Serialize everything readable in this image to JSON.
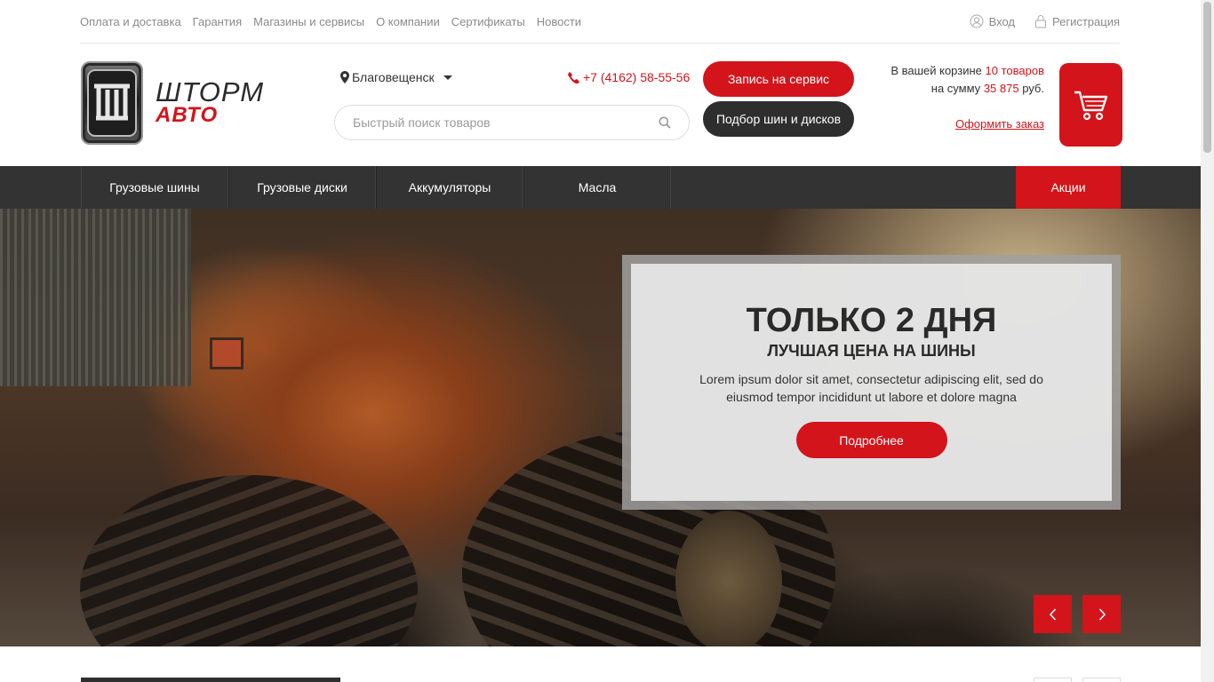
{
  "top_links": [
    "Оплата и доставка",
    "Гарантия",
    "Магазины и сервисы",
    "О компании",
    "Сертификаты",
    "Новости"
  ],
  "account": {
    "login": "Вход",
    "register": "Регистрация"
  },
  "logo": {
    "line1": "ШТОРМ",
    "line2": "АВТО"
  },
  "city": "Благовещенск",
  "phone": "+7 (4162) 58-55-56",
  "search": {
    "placeholder": "Быстрый поиск товаров"
  },
  "buttons": {
    "service": "Запись на сервис",
    "tire_pick": "Подбор шин и дисков"
  },
  "cart": {
    "line1_prefix": "В вашей корзине",
    "count": "10 товаров",
    "line2_prefix": "на сумму",
    "sum": "35 875",
    "currency": "руб.",
    "order": "Оформить заказ"
  },
  "nav": {
    "items": [
      "Грузовые шины",
      "Грузовые диски",
      "Аккумуляторы",
      "Масла"
    ],
    "promo": "Акции"
  },
  "hero": {
    "title": "ТОЛЬКО 2 ДНЯ",
    "subtitle": "ЛУЧШАЯ ЦЕНА НА ШИНЫ",
    "text": "Lorem ipsum dolor sit amet, consectetur adipiscing elit, sed do eiusmod tempor incididunt ut labore et dolore magna",
    "button": "Подробнее"
  },
  "colors": {
    "accent": "#d3141a",
    "dark": "#333333"
  }
}
